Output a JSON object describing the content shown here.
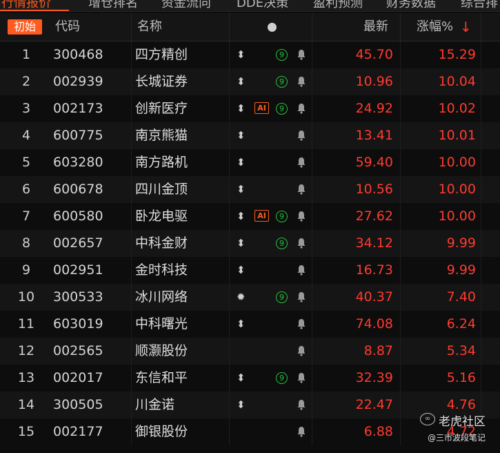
{
  "tabs": [
    {
      "label": "行情报价",
      "active": true
    },
    {
      "label": "增仓排名",
      "active": false
    },
    {
      "label": "资金流向",
      "active": false
    },
    {
      "label": "DDE决策",
      "active": false
    },
    {
      "label": "盈利预测",
      "active": false
    },
    {
      "label": "财务数据",
      "active": false
    },
    {
      "label": "综合排",
      "active": false
    }
  ],
  "header": {
    "init_button": "初始",
    "code": "代码",
    "name": "名称",
    "price": "最新",
    "change": "涨幅%",
    "sort_arrow": "↓"
  },
  "colors": {
    "accent": "#ff5a1f",
    "up_red": "#ff3b30",
    "badge_green": "#24c23b",
    "background": "#0d0d0d"
  },
  "icons": {
    "arrow": "up-down-arrow-icon",
    "ai": "ai-badge-icon",
    "nine": "nine-badge-icon",
    "bell": "bell-icon",
    "star": "starburst-icon"
  },
  "rows": [
    {
      "no": "1",
      "code": "300468",
      "name": "四方精创",
      "price": "45.70",
      "change": "15.29",
      "arrow": "⬍",
      "ai": "",
      "nine": "9",
      "bell": "🔔"
    },
    {
      "no": "2",
      "code": "002939",
      "name": "长城证券",
      "price": "10.96",
      "change": "10.04",
      "arrow": "⬍",
      "ai": "",
      "nine": "9",
      "bell": "🔔"
    },
    {
      "no": "3",
      "code": "002173",
      "name": "创新医疗",
      "price": "24.92",
      "change": "10.02",
      "arrow": "⬍",
      "ai": "AI",
      "nine": "9",
      "bell": "🔔"
    },
    {
      "no": "4",
      "code": "600775",
      "name": "南京熊猫",
      "price": "13.41",
      "change": "10.01",
      "arrow": "⬍",
      "ai": "",
      "nine": "",
      "bell": "🔔"
    },
    {
      "no": "5",
      "code": "603280",
      "name": "南方路机",
      "price": "59.40",
      "change": "10.00",
      "arrow": "⬍",
      "ai": "",
      "nine": "",
      "bell": "🔔"
    },
    {
      "no": "6",
      "code": "600678",
      "name": "四川金顶",
      "price": "10.56",
      "change": "10.00",
      "arrow": "⬍",
      "ai": "",
      "nine": "",
      "bell": "🔔"
    },
    {
      "no": "7",
      "code": "600580",
      "name": "卧龙电驱",
      "price": "27.62",
      "change": "10.00",
      "arrow": "⬍",
      "ai": "AI",
      "nine": "9",
      "bell": "🔔"
    },
    {
      "no": "8",
      "code": "002657",
      "name": "中科金财",
      "price": "34.12",
      "change": "9.99",
      "arrow": "⬍",
      "ai": "",
      "nine": "9",
      "bell": "🔔"
    },
    {
      "no": "9",
      "code": "002951",
      "name": "金时科技",
      "price": "16.73",
      "change": "9.99",
      "arrow": "⬍",
      "ai": "",
      "nine": "",
      "bell": "🔔"
    },
    {
      "no": "10",
      "code": "300533",
      "name": "冰川网络",
      "price": "40.37",
      "change": "7.40",
      "arrow": "✹",
      "ai": "",
      "nine": "9",
      "bell": "🔔"
    },
    {
      "no": "11",
      "code": "603019",
      "name": "中科曙光",
      "price": "74.08",
      "change": "6.24",
      "arrow": "⬍",
      "ai": "",
      "nine": "",
      "bell": "🔔"
    },
    {
      "no": "12",
      "code": "002565",
      "name": "顺灏股份",
      "price": "8.87",
      "change": "5.34",
      "arrow": "",
      "ai": "",
      "nine": "",
      "bell": "🔔"
    },
    {
      "no": "13",
      "code": "002017",
      "name": "东信和平",
      "price": "32.39",
      "change": "5.16",
      "arrow": "⬍",
      "ai": "",
      "nine": "9",
      "bell": "🔔"
    },
    {
      "no": "14",
      "code": "300505",
      "name": "川金诺",
      "price": "22.47",
      "change": "4.76",
      "arrow": "⬍",
      "ai": "",
      "nine": "",
      "bell": "🔔"
    },
    {
      "no": "15",
      "code": "002177",
      "name": "御银股份",
      "price": "6.88",
      "change": "4.72",
      "arrow": "",
      "ai": "",
      "nine": "",
      "bell": "🔔"
    }
  ],
  "watermark": {
    "logo": "∞",
    "main": "老虎社区",
    "sub": "@三市波段笔记"
  }
}
